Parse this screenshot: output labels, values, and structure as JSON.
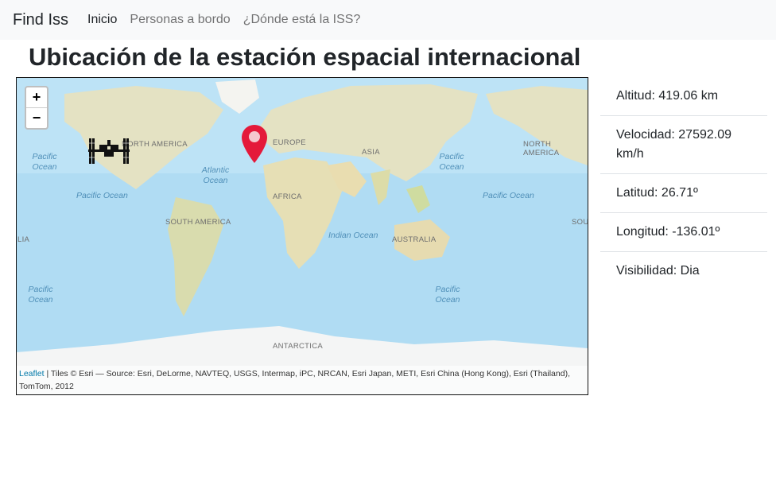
{
  "nav": {
    "brand": "Find Iss",
    "links": [
      "Inicio",
      "Personas a bordo",
      "¿Dónde está la ISS?"
    ]
  },
  "page": {
    "title": "Ubicación de la estación espacial internacional"
  },
  "map": {
    "zoom_in": "+",
    "zoom_out": "−",
    "labels": {
      "north_america": "NORTH AMERICA",
      "north_america_right": "NORTH AMERICA",
      "europe": "EUROPE",
      "asia": "ASIA",
      "africa": "AFRICA",
      "south_america": "SOUTH AMERICA",
      "australia": "AUSTRALIA",
      "antarctica": "ANTARCTICA",
      "atlantic": "Atlantic Ocean",
      "pacific_nw": "Pacific Ocean",
      "pacific_w": "Pacific Ocean",
      "pacific_sw": "Pacific Ocean",
      "pacific_ne": "Pacific Ocean",
      "pacific_e": "Pacific Ocean",
      "pacific_se": "Pacific Ocean",
      "indian": "Indian Ocean",
      "edge_left": "LIA",
      "edge_right": "SOU"
    },
    "attribution": {
      "leaflet": "Leaflet",
      "text": " | Tiles © Esri — Source: Esri, DeLorme, NAVTEQ, USGS, Intermap, iPC, NRCAN, Esri Japan, METI, Esri China (Hong Kong), Esri (Thailand), TomTom, 2012"
    },
    "colors": {
      "ocean": "#b0dcf3",
      "land": "#e8e4c9",
      "marker": "#e4193a"
    }
  },
  "info": {
    "altitude": "Altitud: 419.06 km",
    "velocity": "Velocidad: 27592.09 km/h",
    "latitude": "Latitud: 26.71º",
    "longitude": "Longitud: -136.01º",
    "visibility": "Visibilidad: Dia"
  }
}
